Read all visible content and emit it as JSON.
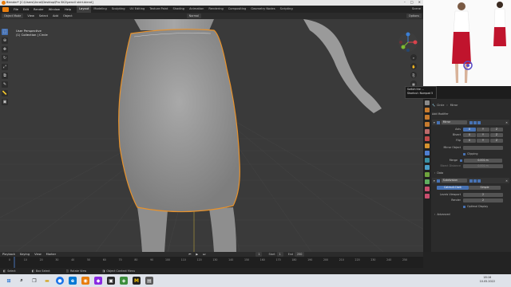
{
  "window": {
    "title": "Blender* [C:\\Users\\Unral\\Desktop\\Pro SK2\\pencil skirt.blend]",
    "controls": [
      "–",
      "□",
      "✕"
    ]
  },
  "menubar": {
    "menus": [
      "File",
      "Edit",
      "Render",
      "Window",
      "Help"
    ],
    "workspaces": [
      "Layout",
      "Modeling",
      "Sculpting",
      "UV Editing",
      "Texture Paint",
      "Shading",
      "Animation",
      "Rendering",
      "Compositing",
      "Geometry Nodes",
      "Scripting"
    ],
    "active_workspace": "Layout",
    "scene_label": "Scene"
  },
  "view_header": {
    "mode": "Object Mode",
    "menus": [
      "View",
      "Select",
      "Add",
      "Object"
    ],
    "orientation": "Normal",
    "options": "Options"
  },
  "viewport": {
    "info_line1": "User Perspective",
    "info_line2": "(1) Collection | Circle"
  },
  "tooltip": {
    "line1": "Switch the ...",
    "line2": "Shortcut: Numpad 5"
  },
  "properties": {
    "breadcrumb_object": "Circle",
    "breadcrumb_modifier": "Mirror",
    "add_modifier": "Add Modifier",
    "mirror": {
      "name": "Mirror",
      "axis_label": "Axis",
      "bisect_label": "Bisect",
      "flip_label": "Flip",
      "xyz": [
        "X",
        "Y",
        "Z"
      ],
      "mirror_object_label": "Mirror Object",
      "clipping_label": "Clipping",
      "merge_label": "Merge",
      "merge_value": "0.001 m",
      "bisect_distance_label": "Bisect Distance",
      "bisect_distance_value": "0.001 m",
      "data_label": "Data"
    },
    "subdivision": {
      "name": "Subdivision",
      "tab_catmull": "Catmull-Clark",
      "tab_simple": "Simple",
      "levels_viewport_label": "Levels Viewport",
      "levels_viewport_value": "2",
      "render_label": "Render",
      "render_value": "2",
      "optimal_display_label": "Optimal Display",
      "advanced_label": "Advanced"
    }
  },
  "timeline": {
    "menus": [
      "Playback",
      "Keying",
      "View",
      "Marker"
    ],
    "current_frame": "1",
    "start_label": "Start",
    "start_value": "1",
    "end_label": "End",
    "end_value": "250",
    "ticks": [
      "0",
      "10",
      "20",
      "30",
      "40",
      "50",
      "60",
      "70",
      "80",
      "90",
      "100",
      "110",
      "120",
      "130",
      "140",
      "150",
      "160",
      "170",
      "180",
      "190",
      "200",
      "210",
      "220",
      "230",
      "240",
      "250"
    ]
  },
  "statusbar": {
    "item1": "Select",
    "item2": "Box Select",
    "item3": "Rotate View",
    "item4": "Object Context Menu"
  },
  "taskbar": {
    "time": "18:16",
    "date": "10.05.2022"
  },
  "colors": {
    "accent": "#4772b3",
    "selection_outline": "#e8922b",
    "skirt_color_reference": "#c0142d"
  }
}
